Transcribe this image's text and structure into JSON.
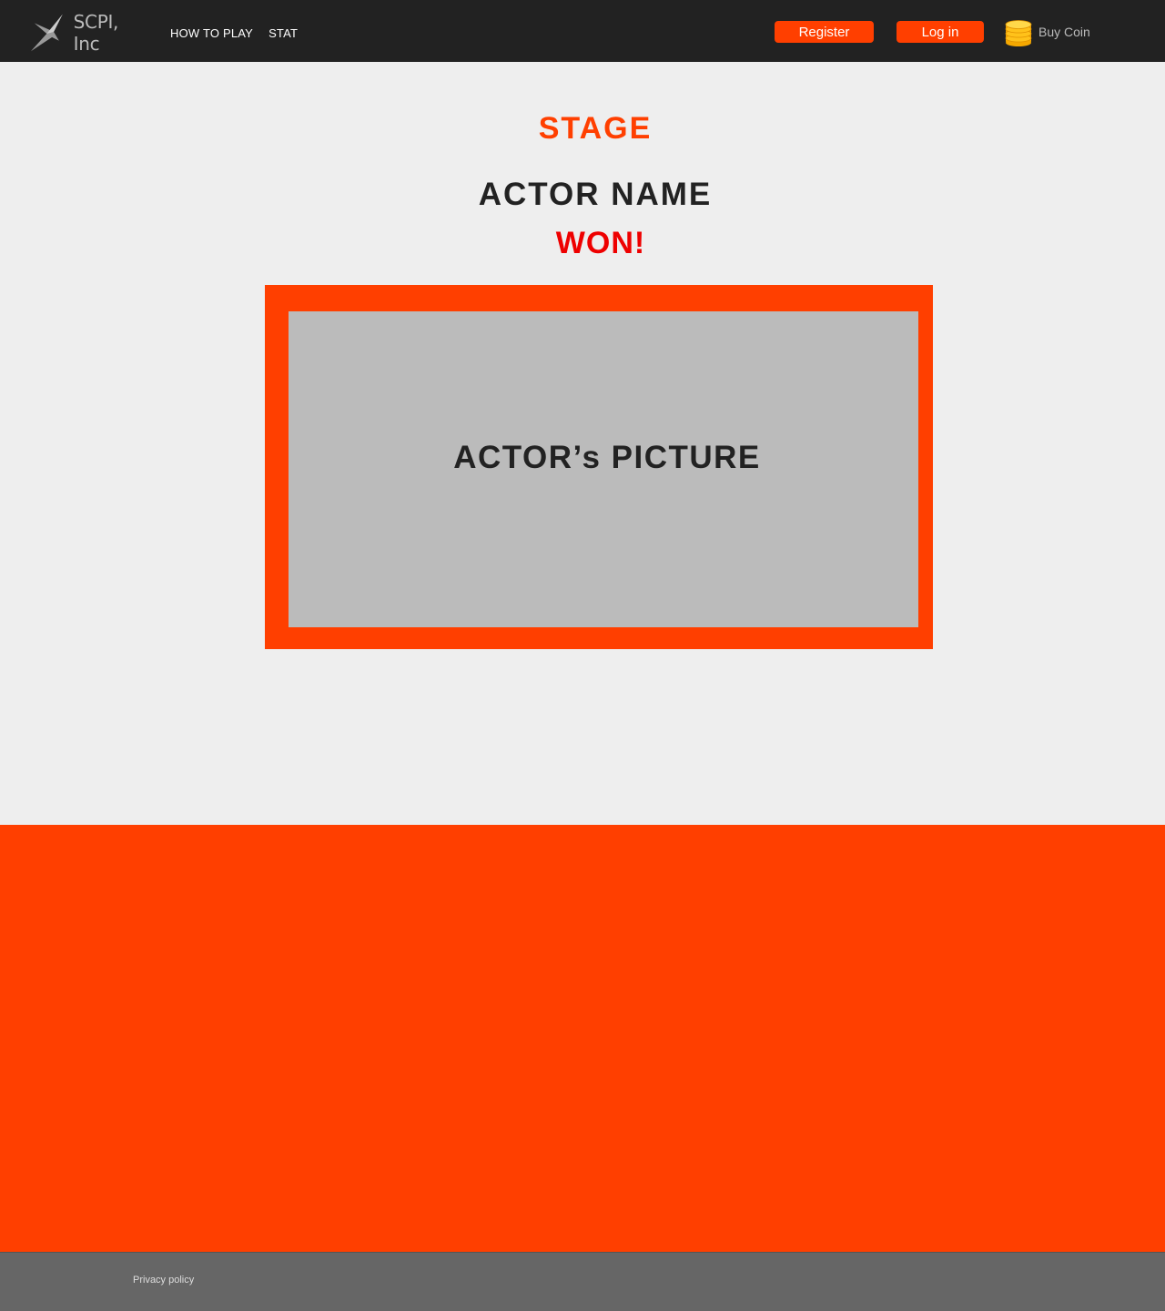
{
  "header": {
    "logo_text": "SCPI, Inc",
    "nav": [
      {
        "label": "HOW TO PLAY"
      },
      {
        "label": "STAT"
      }
    ],
    "register_label": "Register",
    "login_label": "Log in",
    "buy_coin_label": "Buy Coin"
  },
  "main": {
    "stage_title": "STAGE",
    "actor_name": "ACTOR NAME",
    "won_text": "WON!",
    "picture_label": "ACTOR’s PICTURE"
  },
  "footer": {
    "privacy_label": "Privacy policy"
  },
  "colors": {
    "accent": "#ff3f00",
    "header_bg": "#222222",
    "page_bg": "#eeeeee",
    "won": "#ee0000",
    "placeholder": "#bbbbbb",
    "footer_bg": "#666666"
  }
}
